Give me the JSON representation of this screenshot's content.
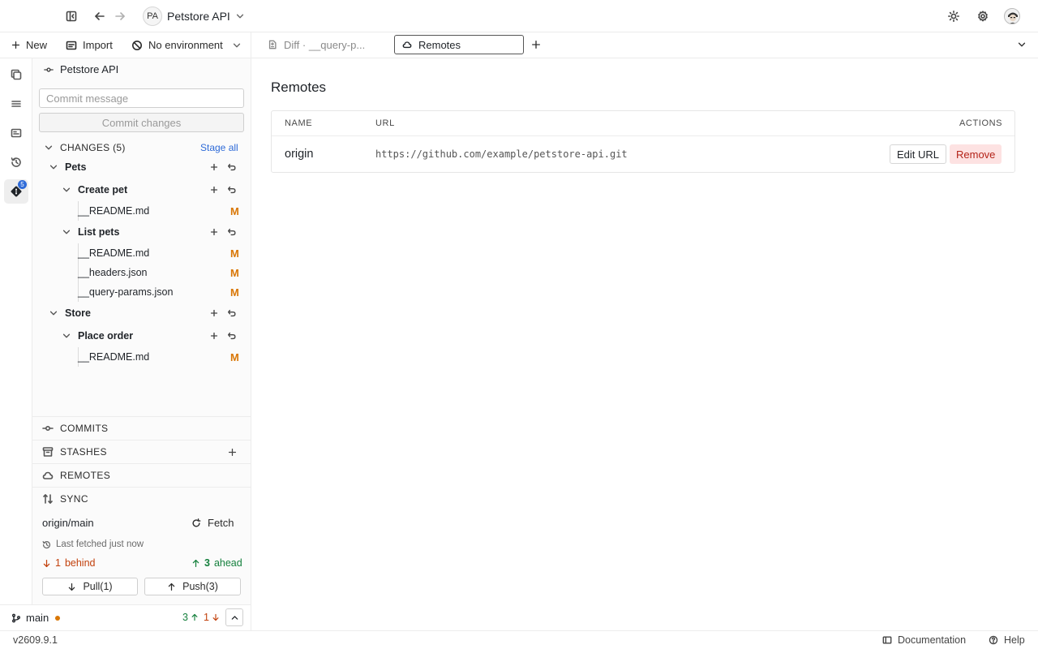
{
  "header": {
    "project_initials": "PA",
    "project_name": "Petstore API"
  },
  "actions": {
    "new_label": "New",
    "import_label": "Import",
    "environment_label": "No environment"
  },
  "rail": {
    "git_badge_count": "5"
  },
  "git": {
    "repo_title": "Petstore API",
    "commit_placeholder": "Commit message",
    "commit_button": "Commit changes",
    "changes_label": "CHANGES (5)",
    "stage_all_label": "Stage all",
    "tree": [
      {
        "label": "Pets"
      },
      {
        "label": "Create pet"
      },
      {
        "label": "__README.md",
        "status": "M"
      },
      {
        "label": "List pets"
      },
      {
        "label": "__README.md",
        "status": "M"
      },
      {
        "label": "__headers.json",
        "status": "M"
      },
      {
        "label": "__query-params.json",
        "status": "M"
      },
      {
        "label": "Store"
      },
      {
        "label": "Place order"
      },
      {
        "label": "__README.md",
        "status": "M"
      }
    ],
    "sections": {
      "commits": "COMMITS",
      "stashes": "STASHES",
      "remotes": "REMOTES",
      "sync": "SYNC"
    },
    "sync": {
      "branch": "origin/main",
      "fetch_label": "Fetch",
      "last_fetched": "Last fetched just now",
      "behind_count": "1",
      "behind_label": "behind",
      "ahead_count": "3",
      "ahead_label": "ahead",
      "pull_label": "Pull(1)",
      "push_label": "Push(3)"
    }
  },
  "branch_bar": {
    "branch": "main",
    "ahead": "3",
    "behind": "1"
  },
  "tabs": [
    {
      "label": "Diff · __query-p..."
    },
    {
      "label": "Remotes"
    }
  ],
  "main": {
    "title": "Remotes",
    "columns": [
      "NAME",
      "URL",
      "ACTIONS"
    ],
    "rows": [
      {
        "name": "origin",
        "url": "https://github.com/example/petstore-api.git",
        "edit_label": "Edit URL",
        "remove_label": "Remove"
      }
    ]
  },
  "footer": {
    "version": "v2609.9.1",
    "documentation_label": "Documentation",
    "help_label": "Help"
  },
  "colors": {
    "modified": "#d97706",
    "ahead": "#15803d",
    "behind": "#c2410c",
    "accent": "#2f6bd8",
    "danger_bg": "#fde2e2",
    "danger_text": "#b42318"
  }
}
